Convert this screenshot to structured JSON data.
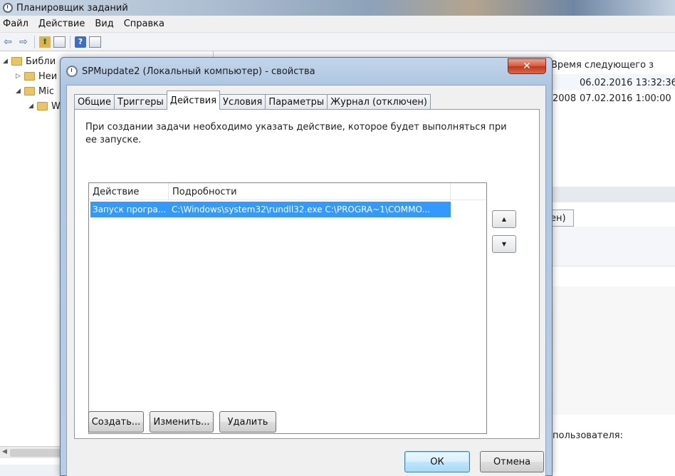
{
  "main_window": {
    "title": "Планировщик заданий",
    "menu": [
      "Файл",
      "Действие",
      "Вид",
      "Справка"
    ],
    "tree": [
      {
        "label": "Библи",
        "indent": 0,
        "arrow": "◢"
      },
      {
        "label": "Неи",
        "indent": 1,
        "arrow": "▷"
      },
      {
        "label": "Mic",
        "indent": 1,
        "arrow": "◢"
      },
      {
        "label": "W",
        "indent": 2,
        "arrow": "◢"
      }
    ],
    "right": {
      "header": "Время следующего з",
      "row1_time": "06.02.2016 13:32:36",
      "row2_partial": "2008",
      "row2_time": "07.02.2016 1:00:00",
      "tab_partial": "ен)",
      "user_label_partial": "пользователя:"
    }
  },
  "dialog": {
    "title": "SPMupdate2 (Локальный компьютер) - свойства",
    "close_label": "✕",
    "tabs": [
      {
        "label": "Общие",
        "active": false
      },
      {
        "label": "Триггеры",
        "active": false
      },
      {
        "label": "Действия",
        "active": true
      },
      {
        "label": "Условия",
        "active": false
      },
      {
        "label": "Параметры",
        "active": false
      },
      {
        "label": "Журнал (отключен)",
        "active": false
      }
    ],
    "description": "При создании задачи необходимо указать действие, которое будет выполняться при ее запуске.",
    "table": {
      "columns": [
        "Действие",
        "Подробности"
      ],
      "rows": [
        {
          "action": "Запуск програ...",
          "details": "C:\\Windows\\system32\\rundll32.exe C:\\PROGRA~1\\COMMO...",
          "selected": true
        }
      ]
    },
    "move_up_label": "▲",
    "move_down_label": "▼",
    "buttons": {
      "create": "Создать...",
      "edit": "Изменить...",
      "delete": "Удалить",
      "ok": "ОК",
      "cancel": "Отмена"
    }
  }
}
